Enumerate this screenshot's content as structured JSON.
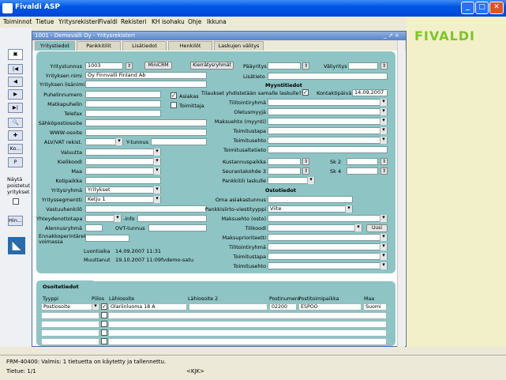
{
  "window": {
    "title": "Fivaldi ASP"
  },
  "menu": [
    "Toiminnot",
    "Tietue",
    "Yritysrekisteri",
    "Fivaldi",
    "Rekisteri",
    "KH isohaku",
    "Ohje",
    "Ikkuna"
  ],
  "brand": {
    "logo_text": "FIVALDI"
  },
  "child": {
    "title": "1001 - Demovalli Oy - Yritysrekisteri",
    "controls": "_ ↗ ×"
  },
  "tabs": [
    "Yritystiedot",
    "Pankkitilit",
    "Lisätiedot",
    "Henkilöt",
    "Laskujen välitys"
  ],
  "left_buttons": {
    "save": "💾",
    "ko": "Ko...",
    "p": "P",
    "hin": "Hin...",
    "show_removed": "Näytä poistetut yritykset"
  },
  "left_form": {
    "yritystunnus_label": "Yritystunnus",
    "yritystunnus": "1003",
    "minicrm": "MiniCRM",
    "kierratysryhmat": "Kierrätysryhmät",
    "yrityksen_nimi_label": "Yrityksen nimi",
    "yrityksen_nimi": "Oy Finnvalli Finland Ab",
    "lisanimi_label": "Yrityksen lisänimi",
    "puhelin_label": "Puhelinnumero",
    "matkapuhelin_label": "Matkapuhelin",
    "telefax_label": "Telefax",
    "sahkoposti_label": "Sähköpostiosoite",
    "www_label": "WWW-osoite",
    "alv_label": "ALV/VAT rekist.",
    "ytunnus_label": "Y-tunnus",
    "asiakas_label": "Asiakas",
    "toimittaja_label": "Toimittaja",
    "valuutta_label": "Valuutta",
    "kielikoodi_label": "Kielikoodi",
    "maa_label": "Maa",
    "kotipaikka_label": "Kotipaikka",
    "yritysryhma_label": "Yritysryhmä",
    "yritysryhma": "Yritykset",
    "yrityssegmentti_label": "Yrityssegmentti",
    "yrityssegmentti": "Ketju 1",
    "vastuuhenkilo_label": "Vastuuhenkilö",
    "yhteydenottotapa_label": "Yhteydenottotapa",
    "info_label": "-info",
    "alennusryhma_label": "Alennusryhmä",
    "ovt_label": "OVT-tunnus",
    "ennakkoperinta_label": "Ennakkoperintärek voimassa",
    "luontiaika_label": "Luontiaika",
    "luontiaika": "14.09.2007 11:31",
    "muuttanut_label": "Muuttanut",
    "muuttanut": "19.10.2007 11:09",
    "muuttaja": "fvdemo-satu"
  },
  "right_form": {
    "paayritys_label": "Pääyritys",
    "valiyritys_label": "Väliyritys",
    "lisatieto_label": "Lisätieto",
    "myynti_header": "Myyntitiedot",
    "tilauksiet_label": "Tilaukset yhdistetään samalle laskulle?",
    "kontaktipaiva_label": "Kontaktipäivä",
    "kontaktipaiva": "14.09.2007",
    "myynti_rows": [
      "Tilitointiryhmä",
      "Oletusmyyjä",
      "Maksuehto (myynti)",
      "Toimitustapa",
      "Toimitusehto",
      "Toimitusaltetieto"
    ],
    "kustannuspaikka_label": "Kustannuspaikka",
    "seurantakohde_label": "Seurantakohde 3",
    "sk2_label": "Sk 2",
    "sk4_label": "Sk 4",
    "pankkitili_label": "Pankkitili laskulle",
    "osto_header": "Ostotiedot",
    "oma_asiakastunnus_label": "Oma asiakastunnus",
    "pankkiviite_label": "Pankkisiirto-viestityyppi",
    "pankkiviite": "Viite",
    "maksuehto_osto_label": "Maksuehto (osto)",
    "tilikoodi_label": "Tilikoodi",
    "uusi": "Uusi",
    "osto_rows": [
      "Maksuprioriteetti",
      "Tilitointiryhmä",
      "Toimitustapa",
      "Toimitusehto"
    ]
  },
  "address": {
    "tab": "Osoitetiedot",
    "headers": [
      "Tyyppi",
      "Piilos",
      "Lähiosoite",
      "Lähiosoite 2",
      "Postinumero",
      "Postitoimipaikka",
      "Maa"
    ],
    "rows": [
      [
        "Postiosoite",
        "",
        "Olariinluoma 18 A",
        "",
        "02200",
        "ESPOO",
        "Suomi"
      ]
    ]
  },
  "status": {
    "message": "FRM-40400: Valmis: 1 tietuetta on käytetty ja tallennettu.",
    "record": "Tietue: 1/1",
    "kbd": "<KJK>"
  }
}
